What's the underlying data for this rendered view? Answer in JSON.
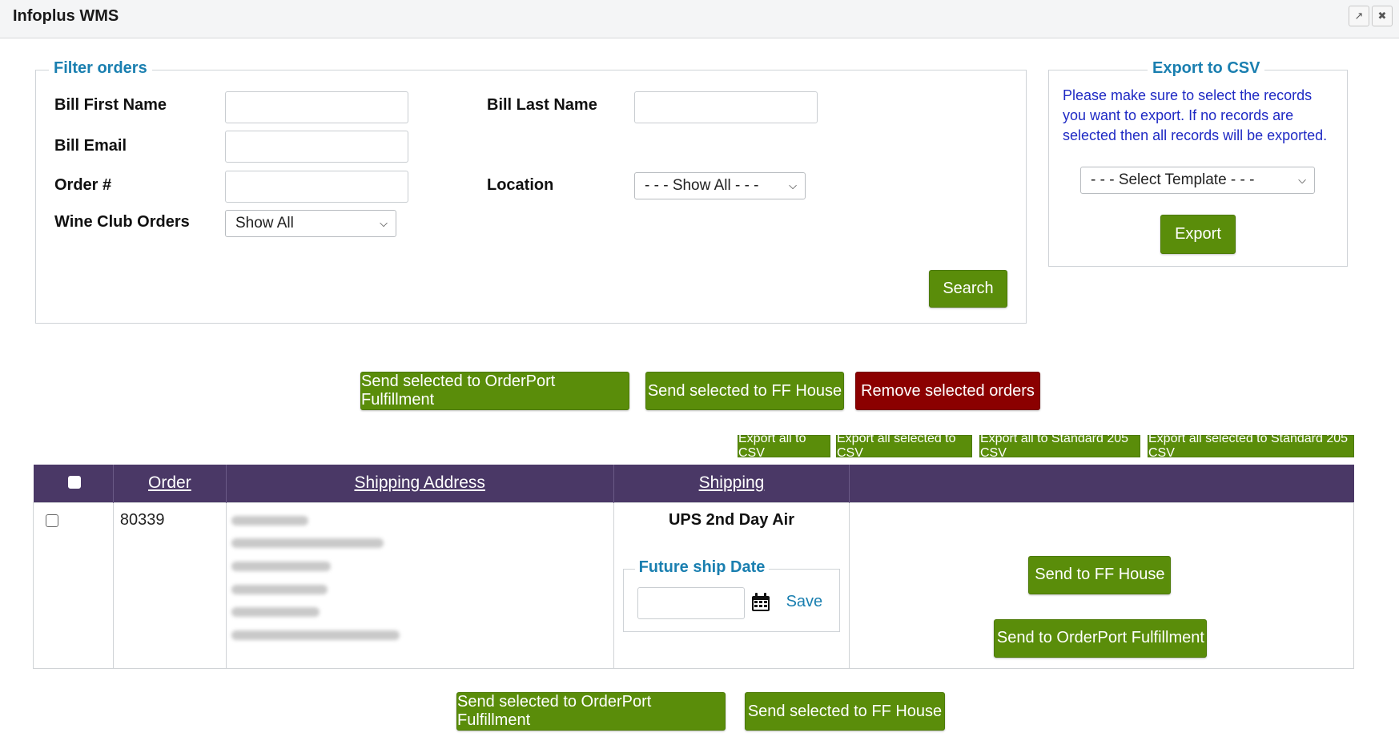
{
  "window": {
    "title": "Infoplus WMS",
    "popout_icon": "popout-icon",
    "close_icon": "close-icon"
  },
  "filter": {
    "legend": "Filter orders",
    "bill_first_name_label": "Bill First Name",
    "bill_first_name_value": "",
    "bill_last_name_label": "Bill Last Name",
    "bill_last_name_value": "",
    "bill_email_label": "Bill Email",
    "bill_email_value": "",
    "order_label": "Order #",
    "order_value": "",
    "location_label": "Location",
    "location_selected": "- - - Show All - - -",
    "wine_club_label": "Wine Club Orders",
    "wine_club_selected": "Show All",
    "search_label": "Search"
  },
  "export": {
    "legend": "Export to CSV",
    "note": "Please make sure to select the records you want to export. If no records are selected then all records will be exported.",
    "template_selected": "- - - Select Template - - -",
    "export_label": "Export"
  },
  "actions_top": {
    "send_orderport": "Send selected to OrderPort Fulfillment",
    "send_ffhouse": "Send selected to FF House",
    "remove": "Remove selected orders"
  },
  "export_links": {
    "all_csv": "Export all to CSV",
    "selected_csv": "Export all selected to CSV",
    "all_std205": "Export all to Standard 205 CSV",
    "selected_std205": "Export all selected to Standard 205 CSV"
  },
  "table": {
    "headers": [
      "",
      "Order",
      "Shipping Address",
      "Shipping",
      ""
    ],
    "rows": [
      {
        "order": "80339",
        "shipping_method": "UPS 2nd Day Air",
        "future_ship_legend": "Future ship Date",
        "future_ship_value": "",
        "save_label": "Save",
        "send_ffhouse": "Send to FF House",
        "send_orderport": "Send to OrderPort Fulfillment"
      }
    ]
  },
  "actions_bottom": {
    "send_orderport": "Send selected to OrderPort Fulfillment",
    "send_ffhouse": "Send selected to FF House"
  },
  "colors": {
    "accent_green": "#5a8d0a",
    "danger_red": "#8b0000",
    "table_header": "#4a3866",
    "legend_blue": "#1a7fb0",
    "note_blue": "#1f2ac4"
  }
}
